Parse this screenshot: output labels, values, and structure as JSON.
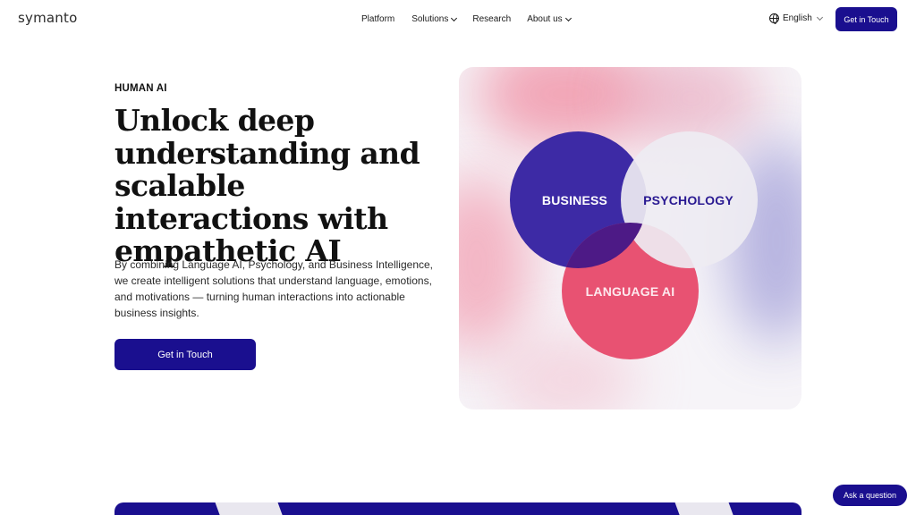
{
  "header": {
    "logo": "symanto",
    "nav": [
      {
        "label": "Platform",
        "dropdown": false
      },
      {
        "label": "Solutions",
        "dropdown": true
      },
      {
        "label": "Research",
        "dropdown": false
      },
      {
        "label": "About us",
        "dropdown": true
      }
    ],
    "language": "English",
    "cta_label": "Get in Touch"
  },
  "hero": {
    "eyebrow": "HUMAN AI",
    "headline": "Unlock deep understanding and scalable interactions with empathetic AI",
    "description": "By combining Language AI, Psychology, and Business Intelligence, we create intelligent solutions that understand language, emotions, and motivations — turning human interactions into actionable business insights.",
    "cta_label": "Get in Touch"
  },
  "venn": {
    "circles": [
      {
        "label": "BUSINESS",
        "color": "#3d2aa5"
      },
      {
        "label": "PSYCHOLOGY",
        "color": "#eeecf2"
      },
      {
        "label": "LANGUAGE AI",
        "color": "#e85272"
      }
    ]
  },
  "chat": {
    "label": "Ask a question"
  },
  "colors": {
    "brand": "#1a0f8f",
    "accent_pink": "#e85272"
  }
}
